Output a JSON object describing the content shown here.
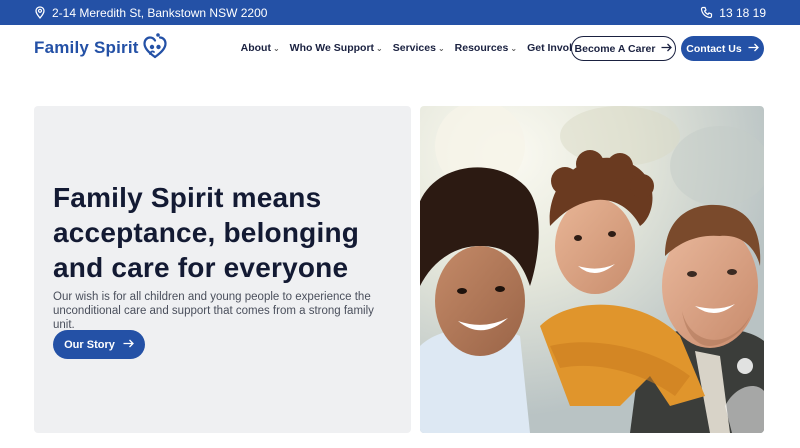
{
  "topbar": {
    "address": "2-14 Meredith St, Bankstown NSW 2200",
    "phone": "13 18 19",
    "location_icon": "location-pin-icon",
    "phone_icon": "phone-icon",
    "background": "#2451a6"
  },
  "header": {
    "logo_text": "Family Spirit",
    "logo_icon": "family-heart-logo-icon",
    "menu": [
      {
        "label": "About"
      },
      {
        "label": "Who We Support"
      },
      {
        "label": "Services"
      },
      {
        "label": "Resources"
      },
      {
        "label": "Get Involved"
      }
    ],
    "become_carer_label": "Become A Carer",
    "contact_label": "Contact Us"
  },
  "hero": {
    "title": "Family Spirit means acceptance, belonging and care for everyone",
    "subtitle": "Our wish is for all children and young people to experience the unconditional care and support that comes from a strong family unit.",
    "cta_label": "Our Story",
    "photo_icon": "family-photo"
  },
  "colors": {
    "brand_blue": "#2451a6",
    "heading_navy": "#131a33",
    "panel_grey": "#eff0f2"
  }
}
